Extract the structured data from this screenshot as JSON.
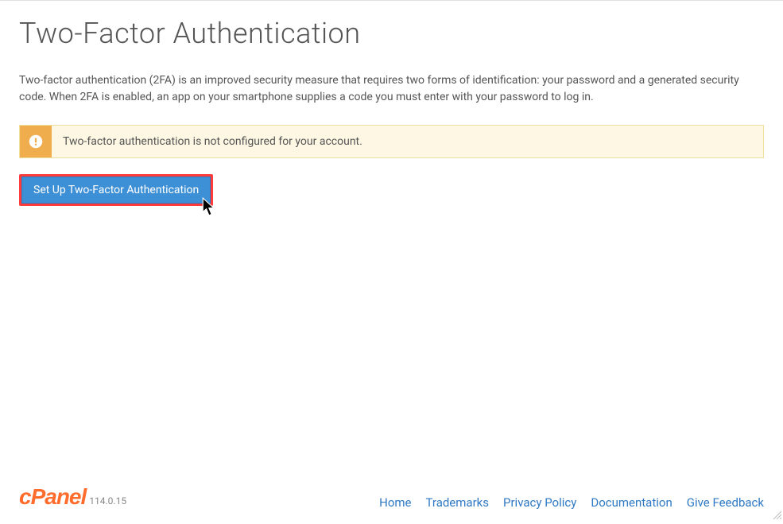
{
  "page": {
    "title": "Two-Factor Authentication",
    "description": "Two-factor authentication (2FA) is an improved security measure that requires two forms of identification: your password and a generated security code. When 2FA is enabled, an app on your smartphone supplies a code you must enter with your password to log in."
  },
  "alert": {
    "message": "Two-factor authentication is not configured for your account."
  },
  "actions": {
    "setup_button": "Set Up Two-Factor Authentication"
  },
  "footer": {
    "logo": "cPanel",
    "version": "114.0.15",
    "links": [
      {
        "label": "Home"
      },
      {
        "label": "Trademarks"
      },
      {
        "label": "Privacy Policy"
      },
      {
        "label": "Documentation"
      },
      {
        "label": "Give Feedback"
      }
    ]
  }
}
